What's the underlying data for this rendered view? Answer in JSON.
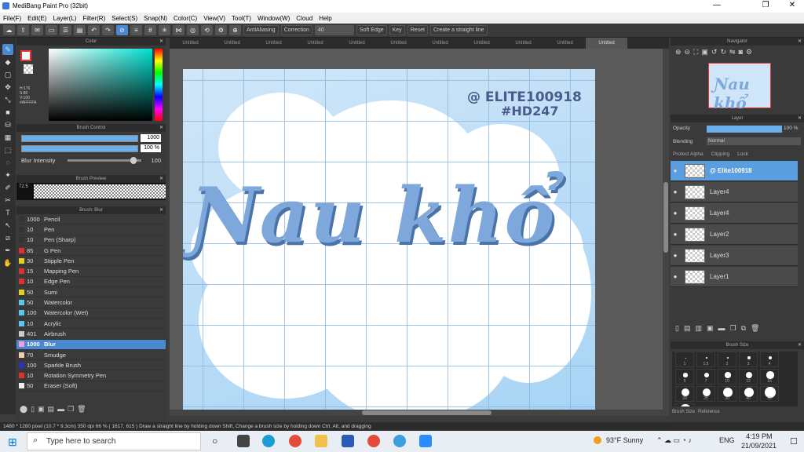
{
  "window": {
    "title": "MediBang Paint Pro (32bit)",
    "minimize": "—",
    "maximize": "❐",
    "close": "✕"
  },
  "menu": [
    "File(F)",
    "Edit(E)",
    "Layer(L)",
    "Filter(R)",
    "Select(S)",
    "Snap(N)",
    "Color(C)",
    "View(V)",
    "Tool(T)",
    "Window(W)",
    "Cloud",
    "Help"
  ],
  "toolbar": {
    "antialiasing": "AntiAliasing",
    "correction_label": "Correction",
    "correction_value": "40",
    "soft_edge": "Soft Edge",
    "key": "Key",
    "reset": "Reset",
    "straight_line": "Create a straight line"
  },
  "tabs": [
    "Untitled",
    "Untitled",
    "Untitled",
    "Untitled",
    "Untitled",
    "Untitled",
    "Untitled",
    "Untitled",
    "Untitled",
    "Untitled",
    "Untitled"
  ],
  "color_panel": {
    "title": "Color",
    "info": [
      "H:176",
      "S:80",
      "V:100",
      "#AFFFFA"
    ]
  },
  "brush_control": {
    "title": "Brush Control",
    "size": "1000",
    "opacity": "100 %",
    "blur_label": "Blur Intensity",
    "blur_value": "100",
    "blur_level": 0.85
  },
  "brush_preview": {
    "title": "Brush Preview",
    "size_label": "72.5"
  },
  "brush_list": {
    "title": "Brush: Blur",
    "items": [
      {
        "size": "1000",
        "name": "Pencil",
        "color": "#333333"
      },
      {
        "size": "10",
        "name": "Pen",
        "color": "#333333"
      },
      {
        "size": "10",
        "name": "Pen (Sharp)",
        "color": "#333333"
      },
      {
        "size": "85",
        "name": "G Pen",
        "color": "#e03030"
      },
      {
        "size": "30",
        "name": "Stipple Pen",
        "color": "#e0d020"
      },
      {
        "size": "15",
        "name": "Mapping Pen",
        "color": "#e03030"
      },
      {
        "size": "10",
        "name": "Edge Pen",
        "color": "#e03030"
      },
      {
        "size": "50",
        "name": "Sumi",
        "color": "#e0d020"
      },
      {
        "size": "50",
        "name": "Watercolor",
        "color": "#5ac8f0"
      },
      {
        "size": "100",
        "name": "Watercolor (Wet)",
        "color": "#5ac8f0"
      },
      {
        "size": "10",
        "name": "Acrylic",
        "color": "#5ac8f0"
      },
      {
        "size": "401",
        "name": "Airbrush",
        "color": "#cccccc"
      },
      {
        "size": "1000",
        "name": "Blur",
        "color": "#f0a0e0"
      },
      {
        "size": "70",
        "name": "Smudge",
        "color": "#f0d0b0"
      },
      {
        "size": "100",
        "name": "Sparkle Brush",
        "color": "#3030c0"
      },
      {
        "size": "10",
        "name": "Rotation Symmetry Pen",
        "color": "#e03030"
      },
      {
        "size": "50",
        "name": "Eraser (Soft)",
        "color": "#eeeeee"
      }
    ],
    "selected_index": 12
  },
  "canvas": {
    "watermark1": "@ ELITE100918",
    "watermark2": "#HD247",
    "big_text": "Ɲau khổ"
  },
  "navigator": {
    "title": "Navigator",
    "thumb_text": "Ɲau khổ"
  },
  "layer_panel": {
    "title": "Layer",
    "opacity_label": "Opacity",
    "opacity_value": "100 %",
    "blending_label": "Blending",
    "blending_value": "Normal",
    "protect_alpha": "Protect Alpha",
    "clipping": "Clipping",
    "lock": "Lock",
    "layers": [
      {
        "name": "@ Elite100918",
        "selected": true
      },
      {
        "name": "Layer4",
        "selected": false
      },
      {
        "name": "Layer4",
        "selected": false
      },
      {
        "name": "Layer2",
        "selected": false
      },
      {
        "name": "Layer3",
        "selected": false
      },
      {
        "name": "Layer1",
        "selected": false
      }
    ]
  },
  "brush_size": {
    "title": "Brush Size",
    "labels": [
      "1",
      "1.5",
      "2",
      "3",
      "4",
      "5",
      "7",
      "10",
      "12",
      "15",
      "20",
      "25",
      "30",
      "40",
      "50",
      "70"
    ],
    "tabs": [
      "Brush Size",
      "Reference"
    ]
  },
  "status": {
    "text": "1480 * 1280 pixel  (10.7 * 9.3cm)  350 dpi  66 %  ( 1617, 615 )  Draw a straight line by holding down Shift, Change a brush size by holding down Ctrl, Alt, and dragging"
  },
  "taskbar": {
    "search_placeholder": "Type here to search",
    "weather": "93°F  Sunny",
    "lang": "ENG",
    "time": "4:19 PM",
    "date": "21/09/2021"
  }
}
